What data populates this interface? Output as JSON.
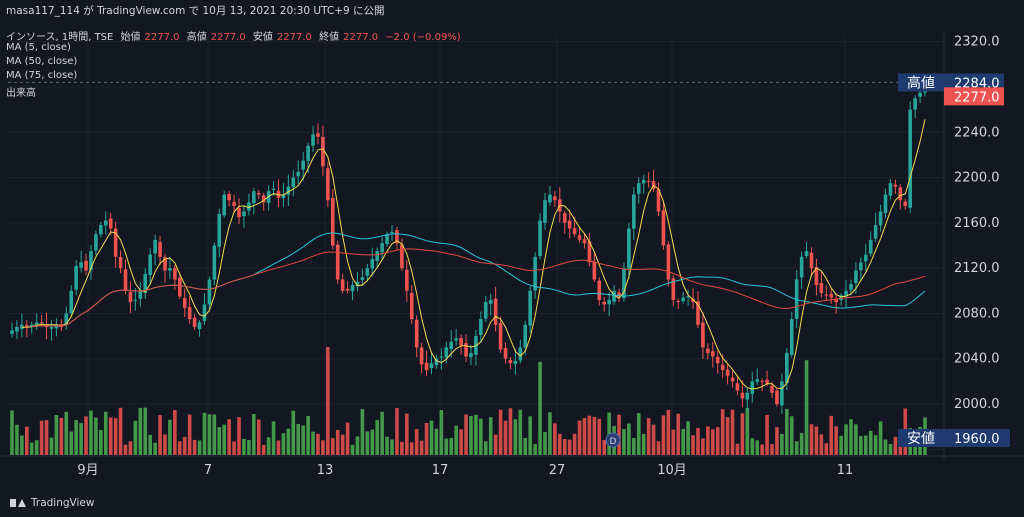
{
  "header": {
    "title": "masa117_114 が TradingView.com で 10月 13, 2021 20:30 UTC+9 に公開",
    "symbol": "インソース, 1時間, TSE",
    "ohlc": [
      {
        "label": "始値",
        "value": "2277.0"
      },
      {
        "label": "高値",
        "value": "2277.0"
      },
      {
        "label": "安値",
        "value": "2277.0"
      },
      {
        "label": "終値",
        "value": "2277.0"
      }
    ],
    "change": "−2.0 (−0.09%)",
    "indicators": [
      "MA (5, close)",
      "MA (50, close)",
      "MA (75, close)",
      "出来高"
    ]
  },
  "price_labels": {
    "high_label": "高値",
    "high_value": "2284.0",
    "last_value": "2277.0",
    "low_label": "安値",
    "low_value": "1960.0"
  },
  "footer": {
    "brand": "TradingView"
  },
  "colors": {
    "background": "#131722",
    "up": "#26a69a",
    "down": "#ef5350",
    "vol_up": "#4caf50",
    "vol_down": "#ef5350",
    "ma5": "#f5d94e",
    "ma50": "#26c6da",
    "ma75": "#e04b3c",
    "label_bg": "#1e3a6e",
    "last_bg": "#ef5350"
  },
  "chart_data": {
    "type": "candlestick",
    "y_axis": {
      "ticks": [
        2320.0,
        2280.0,
        2240.0,
        2200.0,
        2160.0,
        2120.0,
        2080.0,
        2040.0,
        2000.0,
        1960.0
      ],
      "range": [
        1955,
        2325
      ]
    },
    "x_axis": {
      "ticks": [
        "9月",
        "7",
        "13",
        "17",
        "27",
        "10月",
        "11"
      ]
    },
    "annotations": [
      "D"
    ],
    "series": [
      {
        "name": "MA (5, close)",
        "color": "#f5d94e"
      },
      {
        "name": "MA (50, close)",
        "color": "#26c6da"
      },
      {
        "name": "MA (75, close)",
        "color": "#e04b3c"
      },
      {
        "name": "出来高",
        "color": "#4caf50"
      }
    ],
    "close": [
      2065,
      2068,
      2070,
      2068,
      2070,
      2072,
      2072,
      2068,
      2068,
      2070,
      2068,
      2080,
      2100,
      2122,
      2125,
      2118,
      2135,
      2150,
      2158,
      2162,
      2155,
      2130,
      2120,
      2100,
      2090,
      2092,
      2100,
      2115,
      2132,
      2145,
      2130,
      2118,
      2120,
      2110,
      2095,
      2085,
      2075,
      2068,
      2072,
      2088,
      2110,
      2140,
      2168,
      2185,
      2180,
      2175,
      2165,
      2170,
      2178,
      2188,
      2185,
      2178,
      2188,
      2190,
      2182,
      2185,
      2192,
      2200,
      2205,
      2215,
      2228,
      2238,
      2236,
      2210,
      2180,
      2140,
      2110,
      2100,
      2100,
      2105,
      2108,
      2112,
      2120,
      2128,
      2135,
      2142,
      2150,
      2152,
      2142,
      2120,
      2100,
      2075,
      2050,
      2035,
      2030,
      2036,
      2040,
      2042,
      2050,
      2055,
      2058,
      2052,
      2042,
      2045,
      2060,
      2075,
      2090,
      2092,
      2070,
      2048,
      2040,
      2036,
      2038,
      2050,
      2070,
      2100,
      2130,
      2162,
      2180,
      2185,
      2180,
      2170,
      2160,
      2155,
      2150,
      2145,
      2142,
      2125,
      2110,
      2092,
      2088,
      2092,
      2100,
      2095,
      2120,
      2155,
      2185,
      2195,
      2198,
      2197,
      2190,
      2170,
      2140,
      2110,
      2092,
      2090,
      2094,
      2095,
      2090,
      2070,
      2050,
      2045,
      2042,
      2036,
      2030,
      2025,
      2020,
      2012,
      2005,
      2010,
      2020,
      2022,
      2020,
      2018,
      2010,
      2000,
      2020,
      2045,
      2075,
      2110,
      2130,
      2135,
      2120,
      2105,
      2098,
      2096,
      2094,
      2090,
      2096,
      2100,
      2106,
      2118,
      2125,
      2132,
      2145,
      2158,
      2170,
      2185,
      2195,
      2192,
      2180,
      2175,
      2260,
      2270,
      2275,
      2277
    ]
  }
}
